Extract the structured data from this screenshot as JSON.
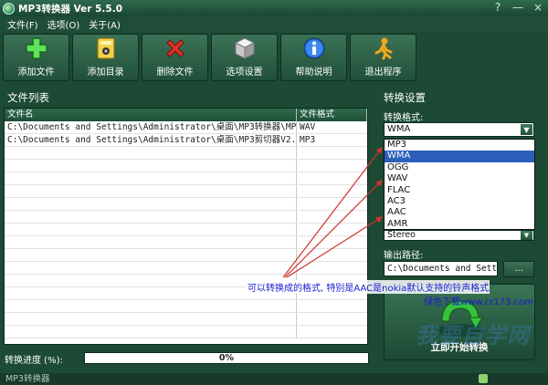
{
  "window": {
    "title": "MP3转换器 Ver 5.5.0",
    "help_label": "?",
    "minimize_label": "—",
    "close_label": "×"
  },
  "menu": {
    "items": [
      "文件(F)",
      "选项(O)",
      "关于(A)"
    ]
  },
  "toolbar": {
    "buttons": [
      {
        "label": "添加文件",
        "icon": "plus-icon"
      },
      {
        "label": "添加目录",
        "icon": "folder-icon"
      },
      {
        "label": "删除文件",
        "icon": "delete-x-icon"
      },
      {
        "label": "选项设置",
        "icon": "cube-icon"
      },
      {
        "label": "帮助说明",
        "icon": "info-icon"
      },
      {
        "label": "退出程序",
        "icon": "exit-runner-icon"
      }
    ]
  },
  "file_list": {
    "title": "文件列表",
    "columns": [
      "文件名",
      "文件格式"
    ],
    "rows": [
      {
        "name": "C:\\Documents and Settings\\Administrator\\桌面\\MP3转换器\\MP...",
        "format": "WAV"
      },
      {
        "name": "C:\\Documents and Settings\\Administrator\\桌面\\MP3剪切器V2....",
        "format": "MP3"
      }
    ]
  },
  "progress": {
    "label": "转换进度 (%):",
    "value": 0,
    "text": "0%"
  },
  "settings": {
    "title": "转换设置",
    "format_label": "转换格式:",
    "format_selected": "WMA",
    "format_options": [
      "MP3",
      "WMA",
      "OGG",
      "WAV",
      "FLAC",
      "AC3",
      "AAC",
      "AMR"
    ],
    "highlighted_option": "WMA",
    "channel_value": "Stereo",
    "output_label": "输出路径:",
    "output_path": "C:\\Documents and Settin",
    "browse_label": "...",
    "convert_label": "立即开始转换"
  },
  "annotation": {
    "text": "可以转换成的格式, 特别是AAC是nokia默认支持的铃声格式",
    "link": "绿色下载www.cr173.com"
  },
  "watermark": {
    "text": "我要自学网"
  },
  "status": {
    "text": "MP3转换器"
  },
  "colors": {
    "bg": "#1c4a34",
    "highlight": "#2c5fbb",
    "annotation": "#1b1bd1",
    "arrow": "#d0322b"
  }
}
